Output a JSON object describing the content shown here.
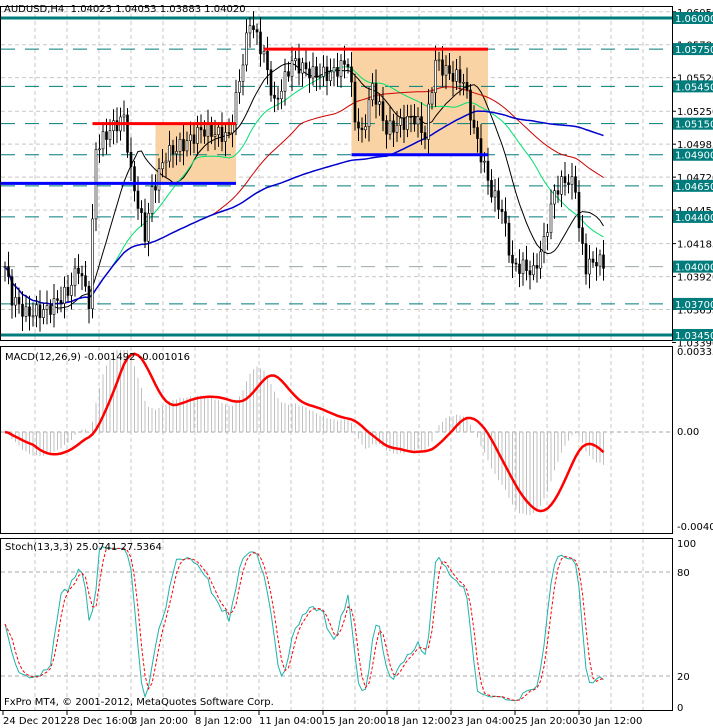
{
  "header": {
    "symbol": "AUDUSD,H4",
    "ohlc": "1.04023 1.04053 1.03883 1.04020"
  },
  "macd_label": "MACD(12,26,9) -0.001492 -0.001016",
  "stoch_label": "Stoch(13,3,3) 25.0741 27.5364",
  "copyright": "FxPro MT4, © 2001-2012, MetaQuotes Software Corp.",
  "colors": {
    "level": "#007C7C",
    "up": "#000000",
    "bull_box": "#F9D3A3",
    "red": "#FF0000",
    "blue": "#0000FF",
    "sma_fast": "#000000",
    "sma_mid": "#00E070",
    "sma_slow": "#CC0000",
    "sma_long": "#0000CC",
    "stoch_main": "#20B2AA",
    "stoch_signal": "#FF0000",
    "hist": "#C0C0C0"
  },
  "chart_data": {
    "type": "candlestick",
    "title": "AUDUSD,H4",
    "ylim": [
      1.0339,
      1.0605
    ],
    "price_ticks": [
      "1.06050",
      "1.05785",
      "1.05520",
      "1.05250",
      "1.04985",
      "1.04720",
      "1.04455",
      "1.04185",
      "1.03920",
      "1.03655",
      "1.03390"
    ],
    "levels": [
      {
        "price": 1.06,
        "label": "1.06000",
        "style": "solid"
      },
      {
        "price": 1.0575,
        "label": "1.05750",
        "style": "dashed"
      },
      {
        "price": 1.0545,
        "label": "1.05450",
        "style": "dashed"
      },
      {
        "price": 1.0515,
        "label": "1.05150",
        "style": "dashed"
      },
      {
        "price": 1.049,
        "label": "1.04900",
        "style": "dashed"
      },
      {
        "price": 1.0465,
        "label": "1.04650",
        "style": "dashed"
      },
      {
        "price": 1.044,
        "label": "1.04400",
        "style": "dashed"
      },
      {
        "price": 1.04,
        "label": "1.04000",
        "style": "current"
      },
      {
        "price": 1.037,
        "label": "1.03700",
        "style": "dashed"
      },
      {
        "price": 1.0345,
        "label": "1.03450",
        "style": "solid"
      }
    ],
    "close_keypoints": [
      [
        0,
        1.04
      ],
      [
        2,
        1.0375
      ],
      [
        6,
        1.0362
      ],
      [
        12,
        1.0365
      ],
      [
        18,
        1.038
      ],
      [
        21,
        1.04
      ],
      [
        24,
        1.0372
      ],
      [
        26,
        1.0495
      ],
      [
        30,
        1.051
      ],
      [
        34,
        1.052
      ],
      [
        36,
        1.0475
      ],
      [
        40,
        1.0425
      ],
      [
        42,
        1.046
      ],
      [
        46,
        1.049
      ],
      [
        52,
        1.05
      ],
      [
        56,
        1.051
      ],
      [
        64,
        1.0505
      ],
      [
        67,
        1.055
      ],
      [
        70,
        1.0598
      ],
      [
        74,
        1.057
      ],
      [
        77,
        1.053
      ],
      [
        82,
        1.0565
      ],
      [
        88,
        1.0555
      ],
      [
        93,
        1.0555
      ],
      [
        98,
        1.0565
      ],
      [
        100,
        1.052
      ],
      [
        102,
        1.0505
      ],
      [
        105,
        1.0545
      ],
      [
        109,
        1.051
      ],
      [
        113,
        1.0515
      ],
      [
        117,
        1.052
      ],
      [
        120,
        1.0505
      ],
      [
        123,
        1.0565
      ],
      [
        127,
        1.0555
      ],
      [
        131,
        1.055
      ],
      [
        134,
        1.051
      ],
      [
        137,
        1.048
      ],
      [
        139,
        1.046
      ],
      [
        142,
        1.0445
      ],
      [
        145,
        1.04
      ],
      [
        148,
        1.04
      ],
      [
        151,
        1.0395
      ],
      [
        154,
        1.042
      ],
      [
        157,
        1.046
      ],
      [
        160,
        1.047
      ],
      [
        163,
        1.0465
      ],
      [
        164,
        1.043
      ],
      [
        166,
        1.04
      ],
      [
        169,
        1.0405
      ],
      [
        171,
        1.0402
      ]
    ],
    "boxes": [
      {
        "from": 43,
        "to": 66,
        "top": 1.0515,
        "bottom": 1.0467
      },
      {
        "from": 99,
        "to": 138,
        "top": 1.0575,
        "bottom": 1.049
      }
    ],
    "red_lines": [
      {
        "from": 25,
        "to": 66,
        "price": 1.0515
      },
      {
        "from": 74,
        "to": 138,
        "price": 1.0575
      }
    ],
    "blue_lines": [
      {
        "from": -2,
        "to": 66,
        "price": 1.0467
      },
      {
        "from": 99,
        "to": 138,
        "price": 1.049
      }
    ],
    "time_labels": [
      "24 Dec 2012",
      "28 Dec 16:00",
      "3 Jan 20:00",
      "8 Jan 12:00",
      "11 Jan 04:00",
      "15 Jan 20:00",
      "18 Jan 12:00",
      "23 Jan 04:00",
      "25 Jan 20:00",
      "30 Jan 12:00"
    ],
    "macd": {
      "params": [
        12,
        26,
        9
      ],
      "main": -0.001492,
      "signal": -0.001016,
      "ylim": [
        -0.00406,
        0.003335
      ],
      "ticks": [
        "0.003335",
        "0.00",
        "-0.00406"
      ]
    },
    "stoch": {
      "params": [
        13,
        3,
        3
      ],
      "main": 25.0741,
      "signal": 27.5364,
      "ylim": [
        0,
        100
      ],
      "ticks": [
        "100",
        "80",
        "20",
        "0"
      ]
    }
  }
}
